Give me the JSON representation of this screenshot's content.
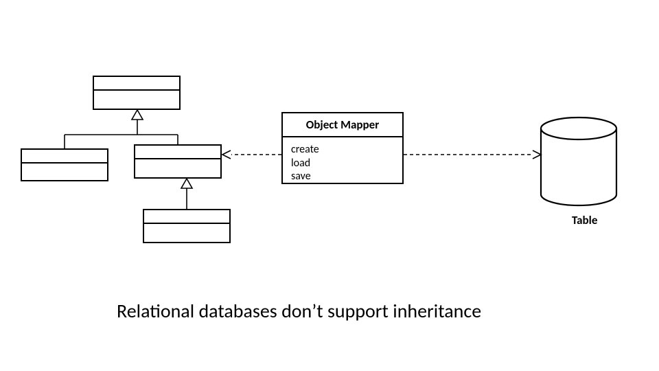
{
  "mapper": {
    "title": "Object Mapper",
    "ops": [
      "create",
      "load",
      "save"
    ]
  },
  "db": {
    "label": "Table"
  },
  "caption": "Relational databases don’t support inheritance"
}
